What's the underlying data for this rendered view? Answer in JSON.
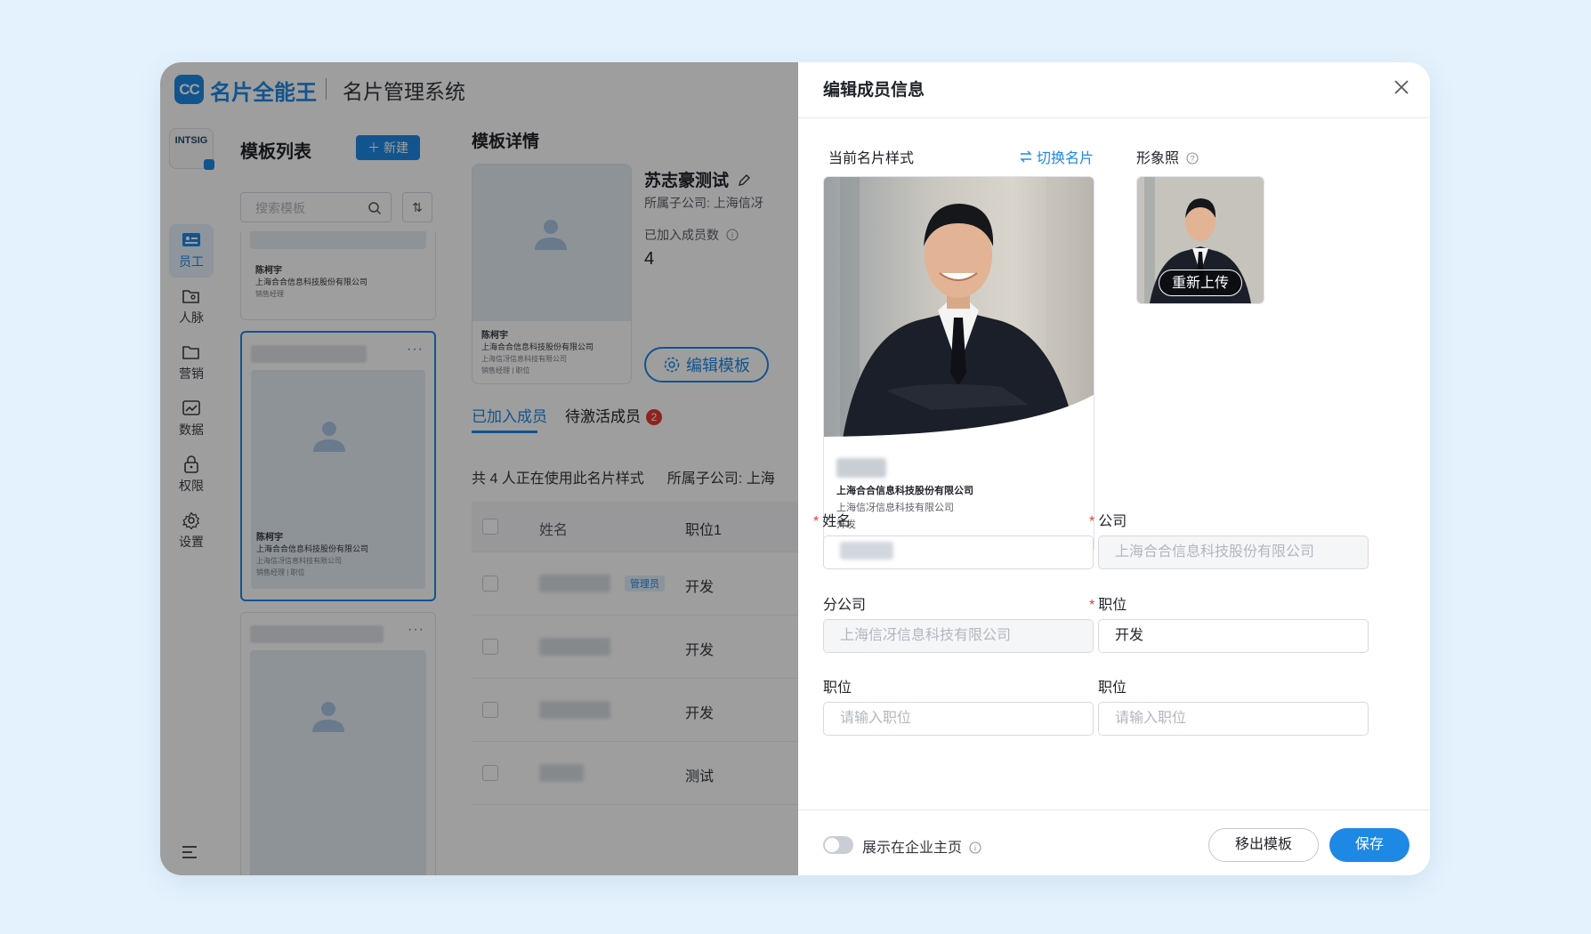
{
  "app": {
    "logo_text": "CC",
    "brand": "名片全能王",
    "system_name": "名片管理系统",
    "org_logo_text": "INTSIG"
  },
  "nav": {
    "items": [
      {
        "label": "员工",
        "icon": "employee-icon",
        "active": true
      },
      {
        "label": "人脉",
        "icon": "contacts-folder-icon",
        "active": false
      },
      {
        "label": "营销",
        "icon": "marketing-folder-icon",
        "active": false
      },
      {
        "label": "数据",
        "icon": "chart-icon",
        "active": false
      },
      {
        "label": "权限",
        "icon": "lock-icon",
        "active": false
      },
      {
        "label": "设置",
        "icon": "gear-icon",
        "active": false
      }
    ]
  },
  "template_list": {
    "title": "模板列表",
    "new_button": "新建",
    "search_placeholder": "搜索模板",
    "cards": [
      {
        "name": "陈柯宇",
        "company": "上海合合信息科技股份有限公司",
        "line3": "销售经理"
      },
      {
        "name": "陈柯宇",
        "company": "上海合合信息科技股份有限公司",
        "line3": "上海信冴信息科技有限公司",
        "line4": "销售经理 | 职位"
      }
    ]
  },
  "template_detail": {
    "title": "模板详情",
    "template_name": "苏志豪测试",
    "subsidiary": "所属子公司: 上海信冴",
    "members_label": "已加入成员数",
    "members_count": "4",
    "edit_button": "编辑模板",
    "preview": {
      "name": "陈柯宇",
      "company": "上海合合信息科技股份有限公司",
      "line3": "上海信冴信息科技有限公司",
      "line4": "销售经理 | 职位"
    },
    "tabs": [
      {
        "label": "已加入成员",
        "active": true
      },
      {
        "label": "待激活成员",
        "badge": "2"
      }
    ],
    "count_line": "共 4 人正在使用此名片样式",
    "subsidiary_filter": "所属子公司: 上海",
    "table": {
      "headers": {
        "name": "姓名",
        "position": "职位1"
      },
      "rows": [
        {
          "position": "开发",
          "tag": "管理员"
        },
        {
          "position": "开发"
        },
        {
          "position": "开发"
        },
        {
          "position": "测试"
        }
      ]
    }
  },
  "drawer": {
    "title": "编辑成员信息",
    "current_style_label": "当前名片样式",
    "switch_card": "切换名片",
    "portrait_label": "形象照",
    "reupload": "重新上传",
    "card": {
      "company": "上海合合信息科技股份有限公司",
      "branch": "上海信冴信息科技有限公司",
      "position": "开发"
    },
    "fields": {
      "name_label": "姓名",
      "company_label": "公司",
      "company_value": "上海合合信息科技股份有限公司",
      "branch_label": "分公司",
      "branch_value": "上海信冴信息科技有限公司",
      "position_label": "职位",
      "position_value": "开发",
      "position2_label": "职位",
      "position2_placeholder": "请输入职位",
      "position3_label": "职位",
      "position3_placeholder": "请输入职位"
    },
    "footer": {
      "show_on_homepage": "展示在企业主页",
      "toggle_on": false,
      "remove_button": "移出模板",
      "save_button": "保存"
    }
  },
  "colors": {
    "accent": "#1e88e5",
    "required": "#e53935",
    "background": "#e4f2fd"
  }
}
